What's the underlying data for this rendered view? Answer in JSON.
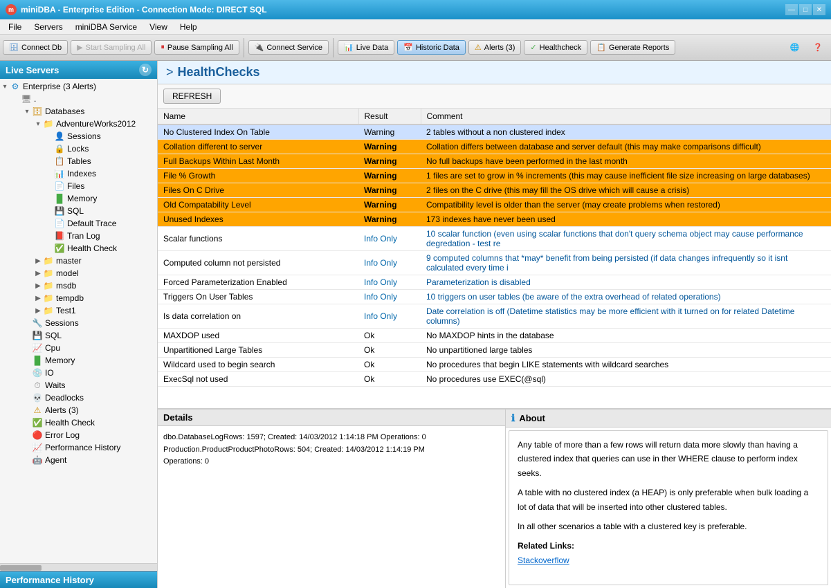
{
  "titlebar": {
    "icon": "m",
    "title": "miniDBA - Enterprise Edition - Connection Mode: DIRECT SQL",
    "controls": [
      "—",
      "□",
      "✕"
    ]
  },
  "menubar": {
    "items": [
      "File",
      "Servers",
      "miniDBA Service",
      "View",
      "Help"
    ]
  },
  "toolbar": {
    "buttons": [
      {
        "id": "connect-db",
        "icon": "🗄",
        "label": "Connect Db",
        "disabled": false
      },
      {
        "id": "start-sampling",
        "icon": "▶",
        "label": "Start Sampling All",
        "disabled": true
      },
      {
        "id": "pause-sampling",
        "icon": "⏸",
        "label": "Pause Sampling All",
        "disabled": false,
        "active": false
      },
      {
        "id": "connect-service",
        "icon": "🔌",
        "label": "Connect Service",
        "disabled": false
      },
      {
        "id": "live-data",
        "icon": "📊",
        "label": "Live Data",
        "disabled": false
      },
      {
        "id": "historic-data",
        "icon": "📅",
        "label": "Historic Data",
        "disabled": false,
        "active": true
      },
      {
        "id": "alerts",
        "icon": "⚠",
        "label": "Alerts (3)",
        "disabled": false
      },
      {
        "id": "healthcheck",
        "icon": "✓",
        "label": "Healthcheck",
        "disabled": false
      },
      {
        "id": "generate-reports",
        "icon": "📋",
        "label": "Generate Reports",
        "disabled": false
      }
    ]
  },
  "left_panel": {
    "header": "Live Servers",
    "footer": "Performance History",
    "tree": [
      {
        "id": "enterprise",
        "level": 0,
        "expand": "▾",
        "icon": "⚙",
        "iconClass": "icon-enterprise",
        "label": "Enterprise (3 Alerts)",
        "selected": false
      },
      {
        "id": "server-root",
        "level": 1,
        "expand": " ",
        "icon": "🖥",
        "iconClass": "icon-server",
        "label": ".",
        "selected": false
      },
      {
        "id": "databases",
        "level": 2,
        "expand": "▾",
        "icon": "🗄",
        "iconClass": "icon-db",
        "label": "Databases",
        "selected": false
      },
      {
        "id": "adventureworks",
        "level": 3,
        "expand": "▾",
        "icon": "📁",
        "iconClass": "icon-db",
        "label": "AdventureWorks2012",
        "selected": false
      },
      {
        "id": "sessions",
        "level": 4,
        "expand": " ",
        "icon": "👤",
        "iconClass": "icon-sessions",
        "label": "Sessions",
        "selected": false
      },
      {
        "id": "locks",
        "level": 4,
        "expand": " ",
        "icon": "🔒",
        "iconClass": "icon-locks",
        "label": "Locks",
        "selected": false
      },
      {
        "id": "tables",
        "level": 4,
        "expand": " ",
        "icon": "📋",
        "iconClass": "icon-table",
        "label": "Tables",
        "selected": false
      },
      {
        "id": "indexes",
        "level": 4,
        "expand": " ",
        "icon": "📊",
        "iconClass": "icon-indexes",
        "label": "Indexes",
        "selected": false
      },
      {
        "id": "files",
        "level": 4,
        "expand": " ",
        "icon": "📄",
        "iconClass": "icon-files",
        "label": "Files",
        "selected": false
      },
      {
        "id": "memory-db",
        "level": 4,
        "expand": " ",
        "icon": "█",
        "iconClass": "icon-memory",
        "label": "Memory",
        "selected": false
      },
      {
        "id": "sql-db",
        "level": 4,
        "expand": " ",
        "icon": "💾",
        "iconClass": "icon-sql",
        "label": "SQL",
        "selected": false
      },
      {
        "id": "default-trace",
        "level": 4,
        "expand": " ",
        "icon": "📄",
        "iconClass": "icon-trace",
        "label": "Default Trace",
        "selected": false
      },
      {
        "id": "tran-log",
        "level": 4,
        "expand": " ",
        "icon": "📕",
        "iconClass": "icon-tranlog",
        "label": "Tran Log",
        "selected": false
      },
      {
        "id": "health-check-db",
        "level": 4,
        "expand": " ",
        "icon": "✅",
        "iconClass": "icon-healthcheck",
        "label": "Health Check",
        "selected": false
      },
      {
        "id": "master",
        "level": 3,
        "expand": "▶",
        "icon": "📁",
        "iconClass": "icon-db",
        "label": "master",
        "selected": false
      },
      {
        "id": "model",
        "level": 3,
        "expand": "▶",
        "icon": "📁",
        "iconClass": "icon-db",
        "label": "model",
        "selected": false
      },
      {
        "id": "msdb",
        "level": 3,
        "expand": "▶",
        "icon": "📁",
        "iconClass": "icon-db",
        "label": "msdb",
        "selected": false
      },
      {
        "id": "tempdb",
        "level": 3,
        "expand": "▶",
        "icon": "📁",
        "iconClass": "icon-db",
        "label": "tempdb",
        "selected": false
      },
      {
        "id": "test1",
        "level": 3,
        "expand": "▶",
        "icon": "📁",
        "iconClass": "icon-db",
        "label": "Test1",
        "selected": false
      },
      {
        "id": "sessions-srv",
        "level": 2,
        "expand": " ",
        "icon": "🔧",
        "iconClass": "icon-sessions",
        "label": "Sessions",
        "selected": false
      },
      {
        "id": "sql-srv",
        "level": 2,
        "expand": " ",
        "icon": "💾",
        "iconClass": "icon-sql",
        "label": "SQL",
        "selected": false
      },
      {
        "id": "cpu",
        "level": 2,
        "expand": " ",
        "icon": "📈",
        "iconClass": "icon-cpu",
        "label": "Cpu",
        "selected": false
      },
      {
        "id": "memory-srv",
        "level": 2,
        "expand": " ",
        "icon": "█",
        "iconClass": "icon-memory",
        "label": "Memory",
        "selected": false
      },
      {
        "id": "io",
        "level": 2,
        "expand": " ",
        "icon": "💿",
        "iconClass": "icon-io",
        "label": "IO",
        "selected": false
      },
      {
        "id": "waits",
        "level": 2,
        "expand": " ",
        "icon": "⏱",
        "iconClass": "icon-waits",
        "label": "Waits",
        "selected": false
      },
      {
        "id": "deadlocks",
        "level": 2,
        "expand": " ",
        "icon": "💀",
        "iconClass": "icon-deadlocks",
        "label": "Deadlocks",
        "selected": false
      },
      {
        "id": "alerts-srv",
        "level": 2,
        "expand": " ",
        "icon": "⚠",
        "iconClass": "icon-alert",
        "label": "Alerts (3)",
        "selected": false
      },
      {
        "id": "health-check-srv",
        "level": 2,
        "expand": " ",
        "icon": "✅",
        "iconClass": "icon-healthcheck",
        "label": "Health Check",
        "selected": false
      },
      {
        "id": "error-log",
        "level": 2,
        "expand": " ",
        "icon": "🔴",
        "iconClass": "icon-errorlog",
        "label": "Error Log",
        "selected": false
      },
      {
        "id": "perf-history",
        "level": 2,
        "expand": " ",
        "icon": "📈",
        "iconClass": "icon-perfhist",
        "label": "Performance History",
        "selected": false
      },
      {
        "id": "agent",
        "level": 2,
        "expand": " ",
        "icon": "🤖",
        "iconClass": "icon-agent",
        "label": "Agent",
        "selected": false
      }
    ]
  },
  "right_panel": {
    "title": "HealthChecks",
    "refresh_btn": "REFRESH",
    "columns": [
      "Name",
      "Result",
      "Comment"
    ],
    "rows": [
      {
        "name": "No Clustered Index On Table",
        "result": "Warning",
        "comment": "2 tables without a non clustered index",
        "style": "selected"
      },
      {
        "name": "Collation different to server",
        "result": "Warning",
        "comment": "Collation differs between database and server default (this may make comparisons difficult)",
        "style": "warning"
      },
      {
        "name": "Full Backups Within Last Month",
        "result": "Warning",
        "comment": "No full backups have been performed in the last month",
        "style": "warning"
      },
      {
        "name": "File % Growth",
        "result": "Warning",
        "comment": "1 files are set to grow in % increments (this may cause inefficient file size increasing on large databases)",
        "style": "warning"
      },
      {
        "name": "Files On C Drive",
        "result": "Warning",
        "comment": "2 files on the C drive (this may fill the OS drive which will cause a crisis)",
        "style": "warning"
      },
      {
        "name": "Old Compatability Level",
        "result": "Warning",
        "comment": "Compatibility level is older than the server (may create problems when restored)",
        "style": "warning"
      },
      {
        "name": "Unused Indexes",
        "result": "Warning",
        "comment": "173 indexes have never been used",
        "style": "warning"
      },
      {
        "name": "Scalar functions",
        "result": "Info Only",
        "comment": "10 scalar function (even using scalar functions that don't query schema object may cause performance degredation - test re",
        "style": "info"
      },
      {
        "name": "Computed column not persisted",
        "result": "Info Only",
        "comment": "9 computed columns that *may* benefit from being persisted (if data changes infrequently so it isnt calculated every time i",
        "style": "info"
      },
      {
        "name": "Forced Parameterization Enabled",
        "result": "Info Only",
        "comment": "Parameterization is disabled",
        "style": "info"
      },
      {
        "name": "Triggers On User Tables",
        "result": "Info Only",
        "comment": "10 triggers on user tables (be aware of the extra overhead of related operations)",
        "style": "info"
      },
      {
        "name": "Is data correlation on",
        "result": "Info Only",
        "comment": "Date correlation is off (Datetime statistics may be more efficient with it turned on for related Datetime columns)",
        "style": "info"
      },
      {
        "name": "MAXDOP used",
        "result": "Ok",
        "comment": "No MAXDOP hints in the database",
        "style": "ok"
      },
      {
        "name": "Unpartitioned Large Tables",
        "result": "Ok",
        "comment": "No unpartitioned large tables",
        "style": "ok"
      },
      {
        "name": "Wildcard used to begin search",
        "result": "Ok",
        "comment": "No procedures that begin LIKE statements with wildcard searches",
        "style": "ok"
      },
      {
        "name": "ExecSql not used",
        "result": "Ok",
        "comment": "No procedures use EXEC(@sql)",
        "style": "ok"
      }
    ]
  },
  "bottom": {
    "details_header": "Details",
    "details_content": [
      "dbo.DatabaseLogRows: 1597;  Created: 14/03/2012 1:14:18 PM   Operations: 0",
      "Production.ProductProductPhotoRows: 504;  Created: 14/03/2012 1:14:19 PM",
      "Operations: 0"
    ],
    "about_header": "About",
    "about_content": {
      "paragraphs": [
        "Any table of more than a few rows will return data more slowly than having a clustered index that queries can use in ther WHERE clause to perform index seeks.",
        "A table with no clustered index (a HEAP) is only preferable when bulk loading a lot of data that will be inserted into other clustered tables.",
        "In all other scenarios a table with a clustered key is preferable."
      ],
      "related_links_label": "Related Links:",
      "links": [
        "Stackoverflow"
      ]
    }
  }
}
